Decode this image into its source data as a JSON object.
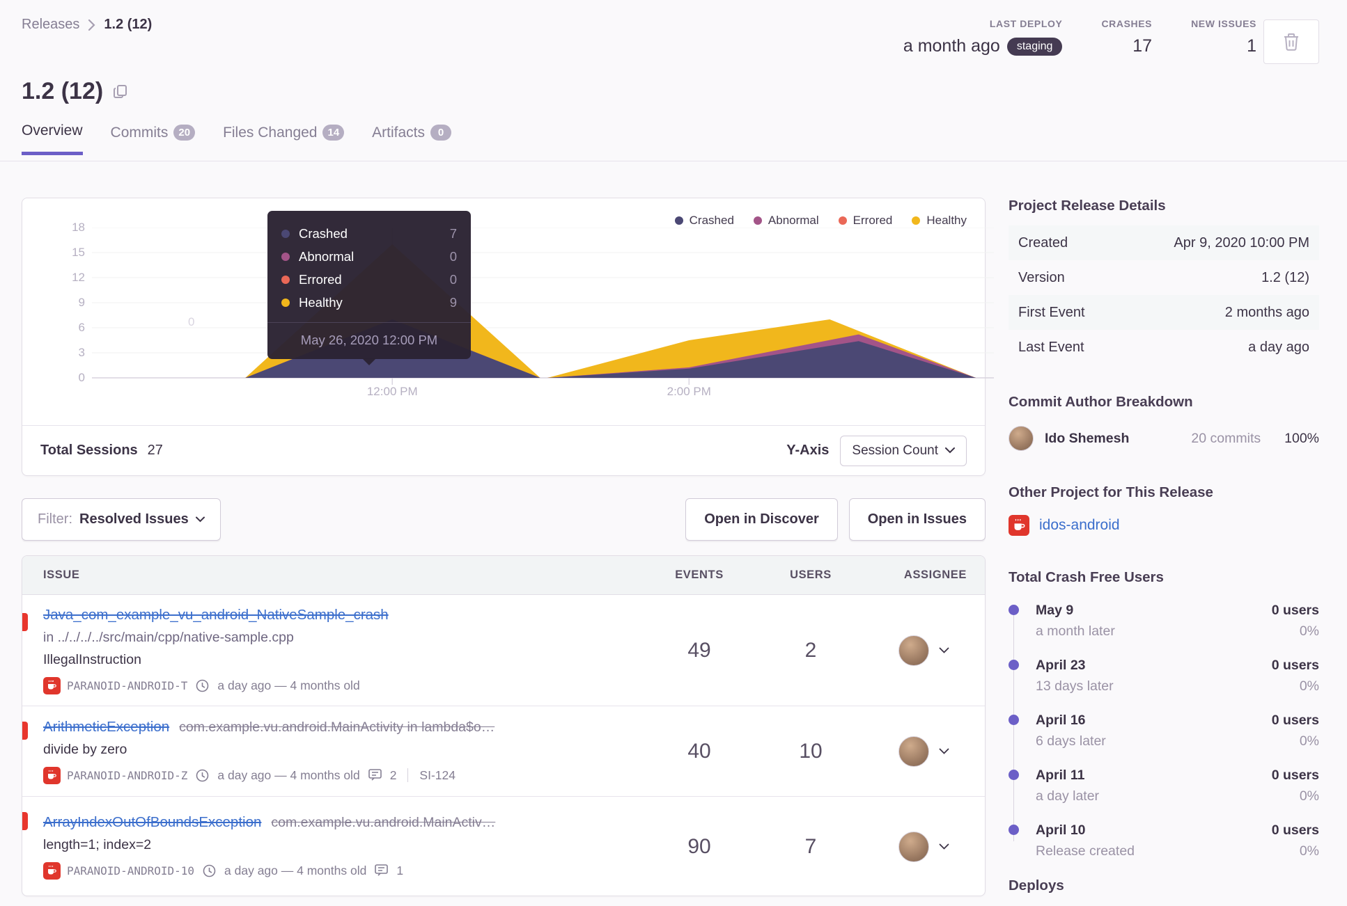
{
  "breadcrumb": {
    "root": "Releases",
    "current": "1.2 (12)"
  },
  "header_stats": {
    "last_deploy": {
      "label": "LAST DEPLOY",
      "value": "a month ago",
      "env": "staging"
    },
    "crashes": {
      "label": "CRASHES",
      "value": "17"
    },
    "new_issues": {
      "label": "NEW ISSUES",
      "value": "1"
    }
  },
  "page": {
    "title": "1.2 (12)"
  },
  "tabs": [
    {
      "label": "Overview"
    },
    {
      "label": "Commits",
      "count": "20"
    },
    {
      "label": "Files Changed",
      "count": "14"
    },
    {
      "label": "Artifacts",
      "count": "0"
    }
  ],
  "chart": {
    "legend": [
      {
        "label": "Crashed",
        "color": "#4b4874"
      },
      {
        "label": "Abnormal",
        "color": "#a35488"
      },
      {
        "label": "Errored",
        "color": "#ea6857"
      },
      {
        "label": "Healthy",
        "color": "#f1b71c"
      }
    ],
    "y_ticks": [
      "18",
      "15",
      "12",
      "9",
      "6",
      "3",
      "0"
    ],
    "x_ticks": [
      {
        "label": "12:00 PM",
        "frac": 0.333
      },
      {
        "label": "2:00 PM",
        "frac": 0.662
      }
    ],
    "watermark": "0",
    "tooltip": {
      "rows": [
        {
          "label": "Crashed",
          "value": "7",
          "color": "#4b4874"
        },
        {
          "label": "Abnormal",
          "value": "0",
          "color": "#a35488"
        },
        {
          "label": "Errored",
          "value": "0",
          "color": "#ea6857"
        },
        {
          "label": "Healthy",
          "value": "9",
          "color": "#f1b71c"
        }
      ],
      "date": "May 26, 2020 12:00 PM"
    },
    "footer": {
      "sessions_label": "Total Sessions",
      "sessions_value": "27",
      "yaxis_label": "Y-Axis",
      "yaxis_value": "Session Count"
    }
  },
  "chart_data": {
    "type": "area",
    "stacked": true,
    "title": "Release session counts over time",
    "ylim": [
      0,
      18
    ],
    "gridline_values": [
      0,
      3,
      6,
      9,
      12,
      15,
      18
    ],
    "x_tick_labels": [
      "12:00 PM",
      "2:00 PM"
    ],
    "hover_x_frac": 0.333,
    "hover_point": {
      "time": "May 26, 2020 12:00 PM",
      "Crashed": 7,
      "Abnormal": 0,
      "Errored": 0,
      "Healthy": 9
    },
    "total_sessions": 27,
    "series": [
      {
        "name": "Crashed",
        "color": "#4b4874",
        "cumulative_top": [
          [
            0,
            0
          ],
          [
            0.17,
            0
          ],
          [
            0.333,
            7
          ],
          [
            0.497,
            0
          ],
          [
            0.505,
            0
          ],
          [
            0.662,
            1.1
          ],
          [
            0.85,
            4.4
          ],
          [
            0.98,
            0
          ]
        ]
      },
      {
        "name": "Abnormal",
        "color": "#a35488",
        "cumulative_top": [
          [
            0,
            0
          ],
          [
            0.17,
            0
          ],
          [
            0.333,
            7
          ],
          [
            0.497,
            0
          ],
          [
            0.505,
            0
          ],
          [
            0.662,
            1.25
          ],
          [
            0.85,
            5.2
          ],
          [
            0.98,
            0
          ]
        ]
      },
      {
        "name": "Errored",
        "color": "#ea6857",
        "cumulative_top": [
          [
            0,
            0
          ],
          [
            0.17,
            0
          ],
          [
            0.333,
            7
          ],
          [
            0.497,
            0
          ],
          [
            0.505,
            0
          ],
          [
            0.662,
            1.25
          ],
          [
            0.85,
            5.2
          ],
          [
            0.98,
            0
          ]
        ]
      },
      {
        "name": "Healthy",
        "color": "#f1b71c",
        "cumulative_top": [
          [
            0,
            0
          ],
          [
            0.17,
            0
          ],
          [
            0.333,
            16
          ],
          [
            0.497,
            0
          ],
          [
            0.505,
            0
          ],
          [
            0.662,
            4.5
          ],
          [
            0.818,
            7
          ],
          [
            0.98,
            0
          ]
        ]
      }
    ]
  },
  "filter": {
    "label": "Filter:",
    "value": "Resolved Issues"
  },
  "actions": {
    "discover": "Open in Discover",
    "issues": "Open in Issues"
  },
  "issues": {
    "columns": {
      "issue": "ISSUE",
      "events": "EVENTS",
      "users": "USERS",
      "assignee": "ASSIGNEE"
    },
    "rows": [
      {
        "title": "Java_com_example_vu_android_NativeSample_crash",
        "location": "in ../../../../src/main/cpp/native-sample.cpp",
        "message": "IllegalInstruction",
        "project": "PARANOID-ANDROID-T",
        "age": "a day ago — 4 months old",
        "events": "49",
        "users": "2"
      },
      {
        "title": "ArithmeticException",
        "culprit": "com.example.vu.android.MainActivity in lambda$o…",
        "message": "divide by zero",
        "project": "PARANOID-ANDROID-Z",
        "age": "a day ago — 4 months old",
        "comments": "2",
        "short_id": "SI-124",
        "events": "40",
        "users": "10"
      },
      {
        "title": "ArrayIndexOutOfBoundsException",
        "culprit": "com.example.vu.android.MainActiv…",
        "message": "length=1; index=2",
        "project": "PARANOID-ANDROID-10",
        "age": "a day ago — 4 months old",
        "comments": "1",
        "events": "90",
        "users": "7"
      }
    ]
  },
  "sidebar": {
    "details": {
      "heading": "Project Release Details",
      "rows": [
        {
          "label": "Created",
          "value": "Apr 9, 2020 10:00 PM"
        },
        {
          "label": "Version",
          "value": "1.2 (12)"
        },
        {
          "label": "First Event",
          "value": "2 months ago"
        },
        {
          "label": "Last Event",
          "value": "a day ago"
        }
      ]
    },
    "authors": {
      "heading": "Commit Author Breakdown",
      "name": "Ido Shemesh",
      "commits": "20 commits",
      "percent": "100%"
    },
    "other_project": {
      "heading": "Other Project for This Release",
      "link": "idos-android"
    },
    "crash_free": {
      "heading": "Total Crash Free Users",
      "items": [
        {
          "date": "May 9",
          "sub": "a month later",
          "users": "0 users",
          "pct": "0%"
        },
        {
          "date": "April 23",
          "sub": "13 days later",
          "users": "0 users",
          "pct": "0%"
        },
        {
          "date": "April 16",
          "sub": "6 days later",
          "users": "0 users",
          "pct": "0%"
        },
        {
          "date": "April 11",
          "sub": "a day later",
          "users": "0 users",
          "pct": "0%"
        },
        {
          "date": "April 10",
          "sub": "Release created",
          "users": "0 users",
          "pct": "0%"
        }
      ]
    },
    "deploys_heading": "Deploys"
  },
  "colors": {
    "accent": "#6c5fc7",
    "link": "#3b6ecc",
    "alert_red": "#e8362d",
    "env_pill_bg": "#453b52"
  }
}
